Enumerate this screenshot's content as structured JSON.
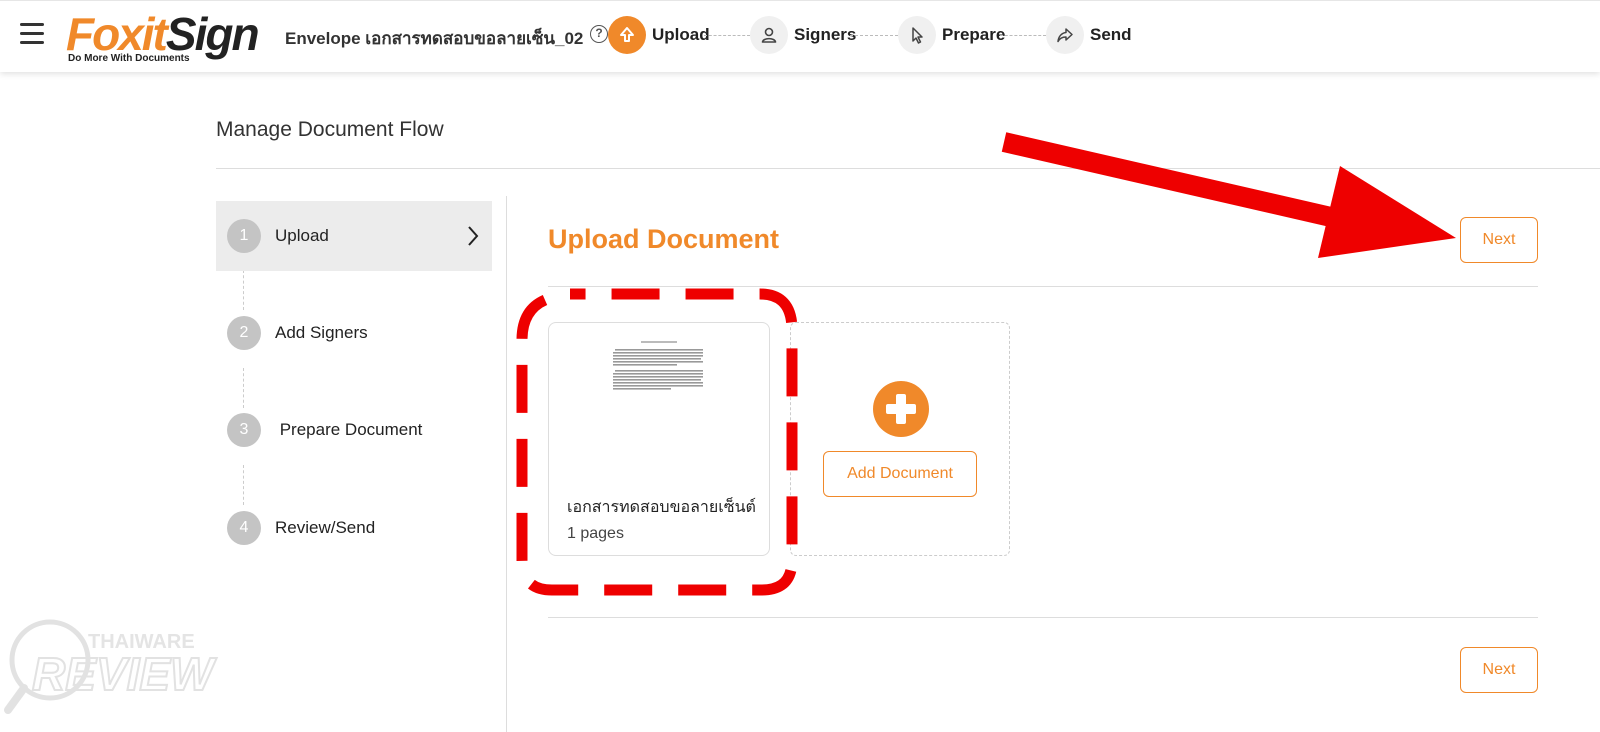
{
  "header": {
    "logo": {
      "brand_primary": "Foxit",
      "brand_secondary": "Sign",
      "tagline": "Do More With Documents"
    },
    "envelope_title": "Envelope เอกสารทดสอบขอลายเซ็น_02",
    "help_icon": "?",
    "steps": [
      {
        "label": "Upload",
        "icon": "upload-icon",
        "active": true
      },
      {
        "label": "Signers",
        "icon": "person-icon",
        "active": false
      },
      {
        "label": "Prepare",
        "icon": "pointer-icon",
        "active": false
      },
      {
        "label": "Send",
        "icon": "share-icon",
        "active": false
      }
    ]
  },
  "page": {
    "title": "Manage Document Flow"
  },
  "nav": {
    "items": [
      {
        "num": "1",
        "label": "Upload",
        "active": true
      },
      {
        "num": "2",
        "label": "Add Signers",
        "active": false
      },
      {
        "num": "3",
        "label": " Prepare Document",
        "active": false
      },
      {
        "num": "4",
        "label": "Review/Send",
        "active": false
      }
    ]
  },
  "main": {
    "section_title": "Upload Document",
    "next_label": "Next",
    "document": {
      "name": "เอกสารทดสอบขอลายเซ็นต์",
      "pages": "1 pages"
    },
    "add_document_label": "Add Document"
  },
  "watermark": {
    "top": "THAIWARE",
    "bottom": "REVIEW"
  },
  "colors": {
    "accent": "#f0892a",
    "annotation": "#ee0000",
    "nav_active_bg": "#ececec"
  }
}
